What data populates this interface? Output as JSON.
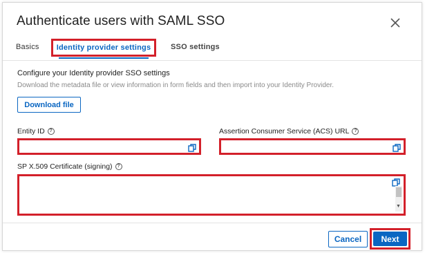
{
  "dialog": {
    "title": "Authenticate users with SAML SSO",
    "close_icon": "close-icon"
  },
  "tabs": [
    {
      "label": "Basics"
    },
    {
      "label": "Identity provider settings",
      "active": true
    },
    {
      "label": "SSO settings"
    }
  ],
  "section": {
    "title": "Configure your Identity provider SSO settings",
    "description": "Download the metadata file or view information in form fields and then import into your Identity Provider."
  },
  "download_button": "Download file",
  "fields": {
    "entity_id": {
      "label": "Entity ID",
      "value": ""
    },
    "acs_url": {
      "label": "Assertion Consumer Service (ACS) URL",
      "value": ""
    },
    "certificate": {
      "label": "SP X.509 Certificate (signing)",
      "value": ""
    }
  },
  "footer": {
    "cancel_label": "Cancel",
    "next_label": "Next"
  },
  "colors": {
    "accent": "#0a66c2",
    "highlight": "#d3202a"
  }
}
